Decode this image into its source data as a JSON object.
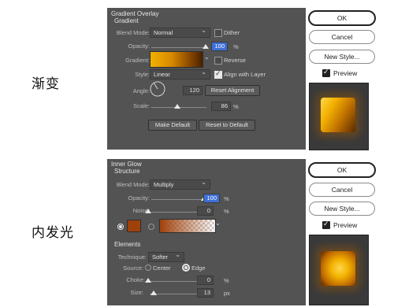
{
  "labels": {
    "gradient_cn": "渐变",
    "inner_glow_cn": "内发光"
  },
  "dialog1": {
    "title": "Gradient Overlay",
    "subtitle": "Gradient",
    "blend_mode_label": "Blend Mode:",
    "blend_mode_value": "Normal",
    "dither_label": "Dither",
    "opacity_label": "Opacity:",
    "opacity_value": "100",
    "percent": "%",
    "gradient_label": "Gradient:",
    "reverse_label": "Reverse",
    "style_label": "Style:",
    "style_value": "Linear",
    "align_label": "Align with Layer",
    "angle_label": "Angle:",
    "angle_value": "120",
    "degree": "°",
    "reset_alignment": "Reset Alignment",
    "scale_label": "Scale:",
    "scale_value": "86",
    "make_default": "Make Default",
    "reset_default": "Reset to Default",
    "ok": "OK",
    "cancel": "Cancel",
    "new_style": "New Style...",
    "preview": "Preview"
  },
  "dialog2": {
    "title": "Inner Glow",
    "structure": "Structure",
    "blend_mode_label": "Blend Mode:",
    "blend_mode_value": "Multiply",
    "opacity_label": "Opacity:",
    "opacity_value": "100",
    "noise_label": "Noise:",
    "noise_value": "0",
    "percent": "%",
    "elements": "Elements",
    "technique_label": "Technique:",
    "technique_value": "Softer",
    "source_label": "Source:",
    "center_label": "Center",
    "edge_label": "Edge",
    "choke_label": "Choke:",
    "choke_value": "0",
    "size_label": "Size:",
    "size_value": "13",
    "px": "px",
    "ok": "OK",
    "cancel": "Cancel",
    "new_style": "New Style...",
    "preview": "Preview"
  },
  "colors": {
    "panel_bg": "#535353",
    "glow_color": "#a0410b",
    "gradient_start": "#f2a800",
    "gradient_end": "#5a2a00"
  }
}
